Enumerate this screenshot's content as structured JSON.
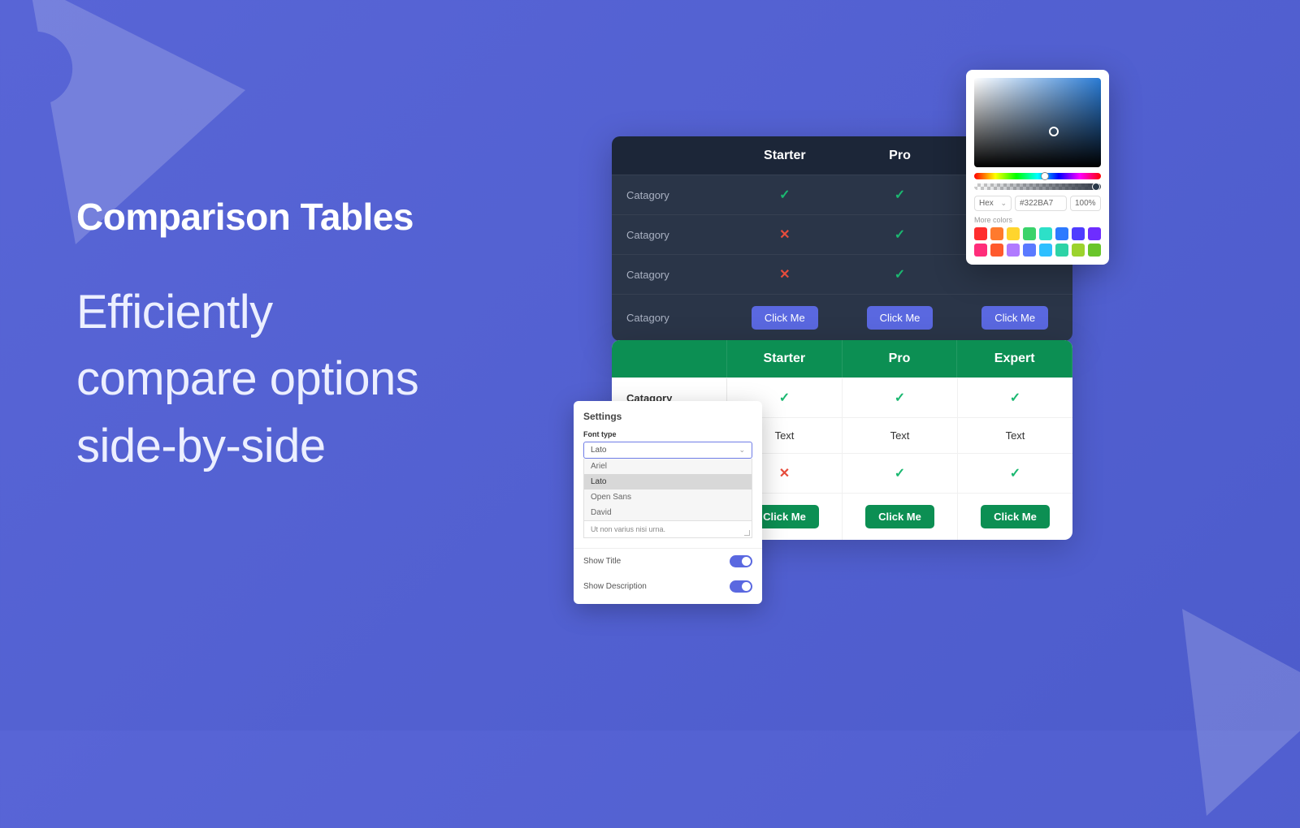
{
  "hero": {
    "title": "Comparison Tables",
    "subtitle_line1": "Efficiently",
    "subtitle_line2": "compare options",
    "subtitle_line3": "side-by-side"
  },
  "table1": {
    "columns": [
      "Starter",
      "Pro"
    ],
    "label": "Catagory",
    "rows": [
      {
        "cells": [
          "check",
          "check"
        ]
      },
      {
        "cells": [
          "cross",
          "check"
        ]
      },
      {
        "cells": [
          "cross",
          "check"
        ]
      }
    ],
    "button_label": "Click Me"
  },
  "table2": {
    "columns": [
      "Starter",
      "Pro",
      "Expert"
    ],
    "label": "Catagory",
    "text_cell": "Text",
    "rows": [
      {
        "cells": [
          "check",
          "check",
          "check"
        ]
      },
      {
        "cells": [
          "text",
          "text",
          "text"
        ]
      },
      {
        "cells": [
          "cross",
          "check",
          "check"
        ]
      }
    ],
    "button_label": "Click Me"
  },
  "settings": {
    "title": "Settings",
    "font_label": "Font type",
    "font_value": "Lato",
    "font_options": [
      "Ariel",
      "Lato",
      "Open Sans",
      "David"
    ],
    "textarea_placeholder": "Ut non varius nisi urna.",
    "toggle1_label": "Show Title",
    "toggle2_label": "Show Description"
  },
  "colorpicker": {
    "mode": "Hex",
    "value": "#322BA7",
    "opacity": "100%",
    "more_label": "More colors",
    "swatches": [
      "#ff2d2d",
      "#ff7a2d",
      "#ffd52d",
      "#3ad36b",
      "#2de0c8",
      "#2d7aff",
      "#4f3cff",
      "#6e2dff",
      "#ff2d7a",
      "#ff5a2d",
      "#b07aff",
      "#5a7aff",
      "#2dbfff",
      "#2dd3a6",
      "#9cd32d",
      "#69c52a"
    ]
  }
}
